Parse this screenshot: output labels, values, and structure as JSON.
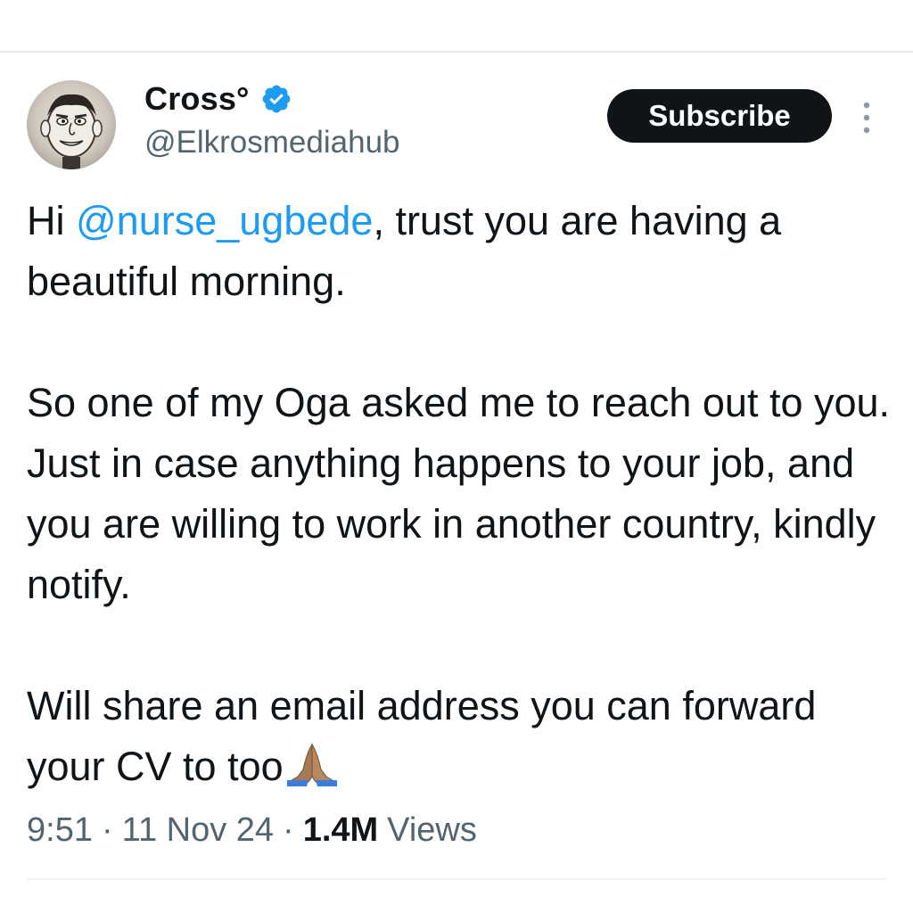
{
  "author": {
    "display_name": "Cross°",
    "handle": "@Elkrosmediahub",
    "verified": true
  },
  "actions": {
    "subscribe_label": "Subscribe"
  },
  "tweet": {
    "line1_prefix": "Hi ",
    "mention": "@nurse_ugbede",
    "line1_suffix": ", trust you are having a beautiful morning.",
    "paragraph2": "So one of my Oga asked me to reach out to you. Just in case anything happens to your job, and you are willing to work in another country, kindly notify.",
    "paragraph3": "Will share an email address you can forward your CV to too"
  },
  "meta": {
    "time": "9:51",
    "separator": "·",
    "date": "11 Nov 24",
    "views_count": "1.4M",
    "views_label": "Views"
  },
  "icons": {
    "verified": "verified-badge-icon",
    "more": "more-vertical-icon",
    "emoji": "folded-hands-emoji"
  },
  "colors": {
    "text": "#0f1419",
    "secondary": "#536471",
    "link": "#1d9bf0",
    "button_bg": "#0f1419",
    "button_text": "#ffffff"
  }
}
